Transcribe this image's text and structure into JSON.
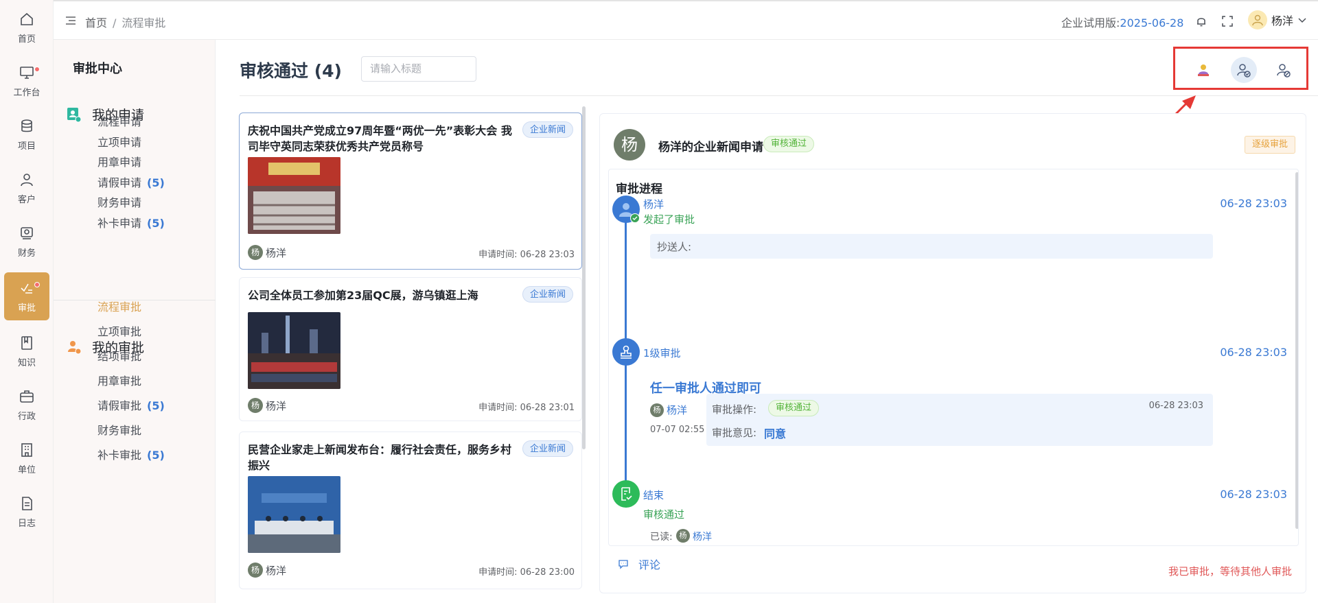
{
  "nav": {
    "items": [
      {
        "label": "首页",
        "icon": "home-icon"
      },
      {
        "label": "工作台",
        "icon": "monitor-icon",
        "dot": true
      },
      {
        "label": "项目",
        "icon": "database-icon"
      },
      {
        "label": "客户",
        "icon": "user-icon"
      },
      {
        "label": "财务",
        "icon": "finance-icon"
      },
      {
        "label": "审批",
        "icon": "approval-icon",
        "active": true,
        "dot": true
      },
      {
        "label": "知识",
        "icon": "book-icon"
      },
      {
        "label": "行政",
        "icon": "briefcase-icon"
      },
      {
        "label": "单位",
        "icon": "building-icon"
      },
      {
        "label": "日志",
        "icon": "document-icon"
      }
    ]
  },
  "header": {
    "breadcrumb_home": "首页",
    "breadcrumb_sep": "/",
    "breadcrumb_current": "流程审批",
    "trial_label": "企业试用版:",
    "trial_date": "2025-06-28",
    "user_name": "杨洋"
  },
  "sidebar": {
    "title": "审批中心",
    "my_requests": {
      "label": "我的申请",
      "items": [
        {
          "label": "流程申请",
          "count": ""
        },
        {
          "label": "立项申请",
          "count": ""
        },
        {
          "label": "用章申请",
          "count": ""
        },
        {
          "label": "请假申请",
          "count": "(5)"
        },
        {
          "label": "财务申请",
          "count": ""
        },
        {
          "label": "补卡申请",
          "count": "(5)"
        }
      ]
    },
    "my_approvals": {
      "label": "我的审批",
      "items": [
        {
          "label": "流程审批",
          "count": "",
          "active": true
        },
        {
          "label": "立项审批",
          "count": ""
        },
        {
          "label": "结项审批",
          "count": ""
        },
        {
          "label": "用章审批",
          "count": ""
        },
        {
          "label": "请假审批",
          "count": "(5)"
        },
        {
          "label": "财务审批",
          "count": ""
        },
        {
          "label": "补卡审批",
          "count": "(5)"
        }
      ]
    }
  },
  "main": {
    "title": "审核通过 (4)",
    "search_placeholder": "请输入标题",
    "annotation_number": "1"
  },
  "cards": [
    {
      "title": "庆祝中国共产党成立97周年暨“两优一先”表彰大会 我司毕守英同志荣获优秀共产党员称号",
      "tag": "企业新闻",
      "author_initial": "杨",
      "author": "杨洋",
      "time": "申请时间: 06-28 23:03"
    },
    {
      "title": "公司全体员工参加第23届QC展，游乌镇逛上海",
      "tag": "企业新闻",
      "author_initial": "杨",
      "author": "杨洋",
      "time": "申请时间: 06-28 23:01"
    },
    {
      "title": "民营企业家走上新闻发布台：履行社会责任，服务乡村振兴",
      "tag": "企业新闻",
      "author_initial": "杨",
      "author": "杨洋",
      "time": "申请时间: 06-28 23:00"
    }
  ],
  "detail": {
    "avatar_initial": "杨",
    "title": "杨洋的企业新闻申请",
    "status": "审核通过",
    "step_mode": "逐级审批",
    "progress_title": "审批进程",
    "start": {
      "name": "杨洋",
      "action": "发起了审批",
      "time": "06-28 23:03",
      "cc_label": "抄送人:"
    },
    "level1": {
      "label": "1级审批",
      "time": "06-28 23:03",
      "rule": "任一审批人通过即可",
      "approver_initial": "杨",
      "approver": "杨洋",
      "approver_time": "07-07 02:55",
      "op_label": "审批操作:",
      "op_status": "审核通过",
      "op_time": "06-28 23:03",
      "opinion_label": "审批意见:",
      "opinion": "同意"
    },
    "end": {
      "label": "结束",
      "status": "审核通过",
      "time": "06-28 23:03",
      "read_label": "已读:",
      "reader_initial": "杨",
      "reader": "杨洋"
    },
    "comment_label": "评论",
    "waiting_text": "我已审批，等待其他人审批"
  }
}
